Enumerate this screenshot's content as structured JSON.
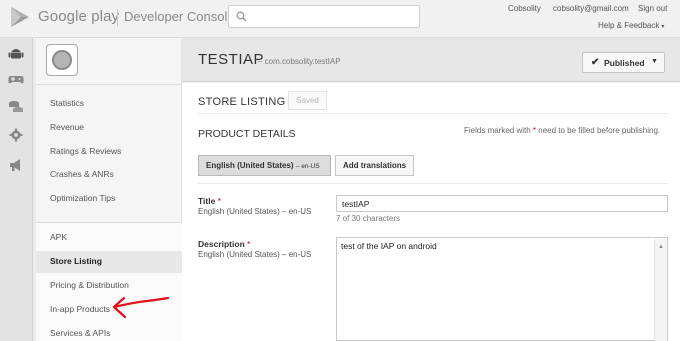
{
  "topbar": {
    "brand": "Google play",
    "brand_sub": "Developer Console",
    "search_placeholder": "",
    "account_name": "Cobsolity",
    "account_email": "cobsolity@gmail.com",
    "sign_out": "Sign out",
    "help_feedback": "Help & Feedback",
    "help_caret": "▾"
  },
  "rail": {
    "icons": [
      "android-icon",
      "gamepad-icon",
      "coins-icon",
      "gear-icon",
      "megaphone-icon"
    ]
  },
  "sidebar": {
    "group1": [
      "Statistics",
      "Revenue",
      "Ratings & Reviews",
      "Crashes & ANRs",
      "Optimization Tips"
    ],
    "group2": [
      "APK",
      "Store Listing",
      "Pricing & Distribution",
      "In-app Products",
      "Services & APIs"
    ],
    "active": "Store Listing"
  },
  "header": {
    "app_title": "TESTIAP",
    "package": "– com.cobsolity.testIAP",
    "status_label": "Published",
    "status_check": "✔",
    "status_caret": "▼"
  },
  "content": {
    "section_title": "STORE LISTING",
    "saved_label": "Saved",
    "product_details": "PRODUCT DETAILS",
    "required_note_pre": "Fields marked with ",
    "required_note_star": "*",
    "required_note_post": " need to be filled before publishing.",
    "language_button": "English (United States)",
    "language_code": "– en-US",
    "add_translations": "Add translations",
    "title_label": "Title",
    "title_star": "*",
    "title_sub": "English (United States) – en-US",
    "title_value": "testIAP",
    "title_count": "7 of 30 characters",
    "description_label": "Description",
    "description_star": "*",
    "description_sub": "English (United States) – en-US",
    "description_value": "test of the IAP on android"
  },
  "colors": {
    "annotation_arrow": "#e0121b",
    "required_star": "#dd0000",
    "play_green": "#4caf50"
  }
}
